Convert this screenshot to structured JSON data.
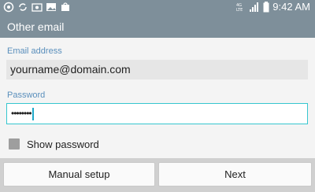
{
  "status_bar": {
    "time": "9:42 AM",
    "network_label": "4G LTE",
    "icons": [
      "notification-icon",
      "sync-icon",
      "gallery-icon",
      "screenshot-icon",
      "store-icon"
    ]
  },
  "header": {
    "title": "Other email"
  },
  "form": {
    "email_label": "Email address",
    "email_value": "yourname@domain.com",
    "password_label": "Password",
    "password_masked": "••••••••",
    "show_password_label": "Show password"
  },
  "buttons": {
    "manual_setup": "Manual setup",
    "next": "Next"
  }
}
